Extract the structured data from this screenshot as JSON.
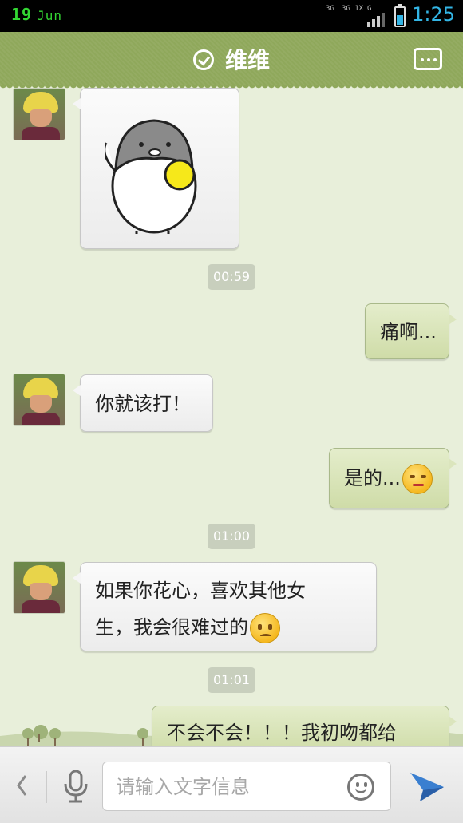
{
  "status_bar": {
    "date_day": "19",
    "date_month": "Jun",
    "network_1": "3G",
    "network_2": "3G 1X",
    "network_3": "G",
    "time": "1:25"
  },
  "header": {
    "title": "维维",
    "accent_color": "#8fa85b"
  },
  "messages": [
    {
      "side": "left",
      "kind": "sticker",
      "sticker_icon": "penguin-holding-ball-icon"
    },
    {
      "kind": "timestamp",
      "text": "00:59"
    },
    {
      "side": "right",
      "kind": "text",
      "text": "痛啊..."
    },
    {
      "side": "left",
      "kind": "text",
      "text": "你就该打！"
    },
    {
      "side": "right",
      "kind": "text",
      "text": "是的...",
      "emoji": "annoyed-face-icon"
    },
    {
      "kind": "timestamp",
      "text": "01:00"
    },
    {
      "side": "left",
      "kind": "text",
      "line1": "如果你花心，喜欢其他女",
      "line2": "生，我会很难过的",
      "emoji": "sad-face-icon"
    },
    {
      "kind": "timestamp",
      "text": "01:01"
    },
    {
      "side": "right",
      "kind": "text",
      "text": "不会不会！！！我初吻都给"
    }
  ],
  "input_bar": {
    "placeholder": "请输入文字信息",
    "back_icon": "chevron-left-icon",
    "mic_icon": "microphone-icon",
    "emoji_icon": "smiley-icon",
    "send_icon": "paper-plane-icon",
    "send_color": "#3a7fd0"
  }
}
